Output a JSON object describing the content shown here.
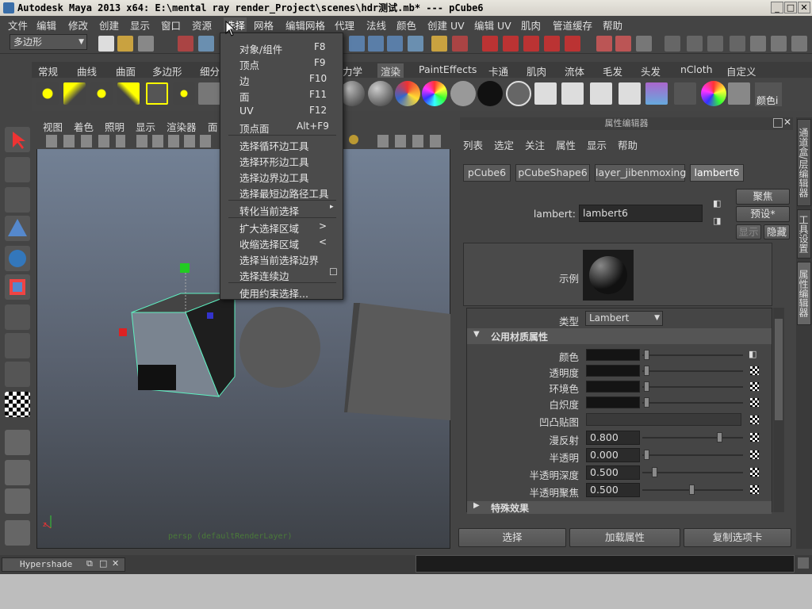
{
  "window": {
    "title": "Autodesk Maya 2013 x64: E:\\mental ray render_Project\\scenes\\hdr测试.mb*   ---   pCube6"
  },
  "menubar": [
    "文件",
    "编辑",
    "修改",
    "创建",
    "显示",
    "窗口",
    "资源",
    "选择",
    "网格",
    "编辑网格",
    "代理",
    "法线",
    "颜色",
    "创建 UV",
    "编辑 UV",
    "肌肉",
    "管道缓存",
    "帮助"
  ],
  "mode_select": {
    "value": "多边形"
  },
  "shelf_tabs": [
    "常规",
    "曲线",
    "曲面",
    "多边形",
    "细分",
    "力学",
    "渲染",
    "PaintEffects",
    "卡通",
    "肌肉",
    "流体",
    "毛发",
    "头发",
    "nCloth",
    "自定义"
  ],
  "shelf_icon_label": "颜色i",
  "viewport": {
    "menu": [
      "视图",
      "着色",
      "照明",
      "显示",
      "渲染器",
      "面"
    ],
    "camera_label": "persp (defaultRenderLayer)"
  },
  "select_menu": {
    "items": [
      {
        "label": "对象/组件",
        "key": "F8"
      },
      {
        "label": "顶点",
        "key": "F9"
      },
      {
        "label": "边",
        "key": "F10"
      },
      {
        "label": "面",
        "key": "F11"
      },
      {
        "label": "UV",
        "key": "F12"
      },
      {
        "label": "顶点面",
        "key": "Alt+F9"
      },
      {
        "label": "选择循环边工具",
        "key": ""
      },
      {
        "label": "选择环形边工具",
        "key": ""
      },
      {
        "label": "选择边界边工具",
        "key": ""
      },
      {
        "label": "选择最短边路径工具",
        "key": ""
      },
      {
        "label": "转化当前选择",
        "key": "▸"
      },
      {
        "label": "扩大选择区域",
        "key": ">"
      },
      {
        "label": "收缩选择区域",
        "key": "<"
      },
      {
        "label": "选择当前选择边界",
        "key": ""
      },
      {
        "label": "选择连续边",
        "key": "☐"
      },
      {
        "label": "使用约束选择...",
        "key": ""
      }
    ]
  },
  "attr_editor": {
    "header": "属性编辑器",
    "menu": [
      "列表",
      "选定",
      "关注",
      "属性",
      "显示",
      "帮助"
    ],
    "tabs": [
      "pCube6",
      "pCubeShape6",
      "layer_jibenmoxing",
      "lambert6"
    ],
    "focus_btn": "聚焦",
    "preset_btn": "预设*",
    "show_btn": "显示",
    "hide_btn": "隐藏",
    "node_label": "lambert:",
    "node_value": "lambert6",
    "sample_label": "示例",
    "type_label": "类型",
    "type_value": "Lambert",
    "section_common": "公用材质属性",
    "attrs": [
      {
        "label": "颜色",
        "value": ""
      },
      {
        "label": "透明度",
        "value": ""
      },
      {
        "label": "环境色",
        "value": ""
      },
      {
        "label": "白炽度",
        "value": ""
      },
      {
        "label": "凹凸贴图",
        "value": ""
      },
      {
        "label": "漫反射",
        "value": "0.800"
      },
      {
        "label": "半透明",
        "value": "0.000"
      },
      {
        "label": "半透明深度",
        "value": "0.500"
      },
      {
        "label": "半透明聚焦",
        "value": "0.500"
      }
    ],
    "section_special": "特殊效果",
    "bottom_buttons": [
      "选择",
      "加载属性",
      "复制选项卡"
    ]
  },
  "side_tabs": [
    "通道盒/层编辑器",
    "工具设置",
    "属性编辑器"
  ],
  "bottom": {
    "hypershade": "Hypershade"
  }
}
